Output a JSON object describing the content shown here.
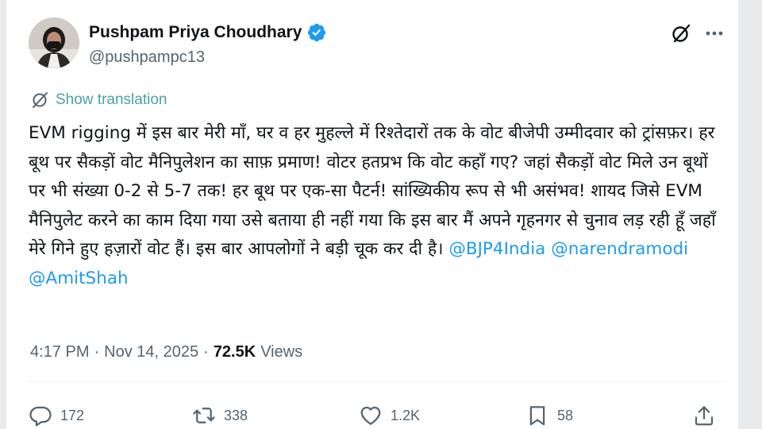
{
  "author": {
    "name": "Pushpam Priya Choudhary",
    "handle": "@pushpampc13",
    "verified": true
  },
  "translate": {
    "label": "Show translation"
  },
  "tweet": {
    "text": "EVM rigging में इस बार मेरी माँ, घर व हर मुहल्ले में रिश्तेदारों तक के वोट बीजेपी उम्मीदवार को ट्रांसफ़र। हर बूथ पर सैकड़ों वोट मैनिपुलेशन का साफ़ प्रमाण! वोटर हतप्रभ कि वोट कहाँ गए? जहां सैकड़ों वोट मिले उन बूथों पर भी संख्या 0-2 से 5-7 तक! हर बूथ पर एक-सा पैटर्न! सांख्यिकीय रूप से भी असंभव! शायद जिसे EVM मैनिपुलेट करने का काम दिया गया उसे बताया ही नहीं गया कि इस बार मैं अपने गृहनगर से चुनाव लड़ रही हूँ जहाँ मेरे गिने हुए हज़ारों वोट हैं। इस बार आपलोगों ने बड़ी चूक कर दी है।",
    "mentions": [
      "@BJP4India",
      "@narendramodi",
      "@AmitShah"
    ]
  },
  "meta": {
    "time": "4:17 PM",
    "separator": "·",
    "date": "Nov 14, 2025",
    "views_count": "72.5K",
    "views_label": "Views"
  },
  "actions": {
    "replies": "172",
    "reposts": "338",
    "likes": "1.2K",
    "bookmarks": "58"
  },
  "colors": {
    "accent": "#1d9bf0",
    "text": "#0f1419",
    "muted": "#536471",
    "background": "#e9eaeb"
  },
  "icons": [
    "verified-badge-icon",
    "grok-icon",
    "more-icon",
    "translate-icon",
    "reply-icon",
    "repost-icon",
    "like-icon",
    "bookmark-icon",
    "share-icon"
  ]
}
